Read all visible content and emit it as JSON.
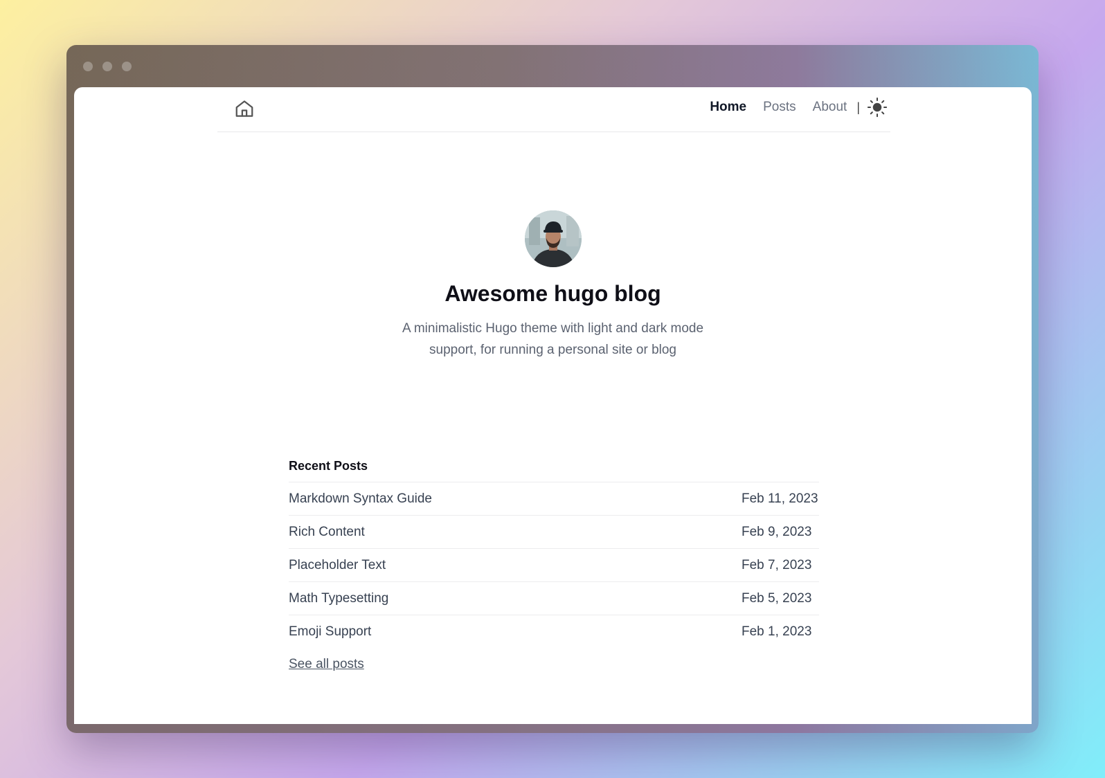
{
  "window": {
    "traffic_lights": [
      "close",
      "minimize",
      "zoom"
    ]
  },
  "nav": {
    "home_icon": "home-icon",
    "links": [
      {
        "label": "Home",
        "active": true
      },
      {
        "label": "Posts",
        "active": false
      },
      {
        "label": "About",
        "active": false
      }
    ],
    "separator": "|",
    "theme_icon": "sun-icon"
  },
  "hero": {
    "title": "Awesome hugo blog",
    "tagline": "A minimalistic Hugo theme with light and dark mode support, for running a personal site or blog"
  },
  "recent": {
    "heading": "Recent Posts",
    "posts": [
      {
        "title": "Markdown Syntax Guide",
        "date": "Feb 11, 2023"
      },
      {
        "title": "Rich Content",
        "date": "Feb 9, 2023"
      },
      {
        "title": "Placeholder Text",
        "date": "Feb 7, 2023"
      },
      {
        "title": "Math Typesetting",
        "date": "Feb 5, 2023"
      },
      {
        "title": "Emoji Support",
        "date": "Feb 1, 2023"
      }
    ],
    "see_all_label": "See all posts"
  },
  "colors": {
    "text_primary": "#0f0f17",
    "text_muted": "#6b7280",
    "divider": "#ececee"
  }
}
